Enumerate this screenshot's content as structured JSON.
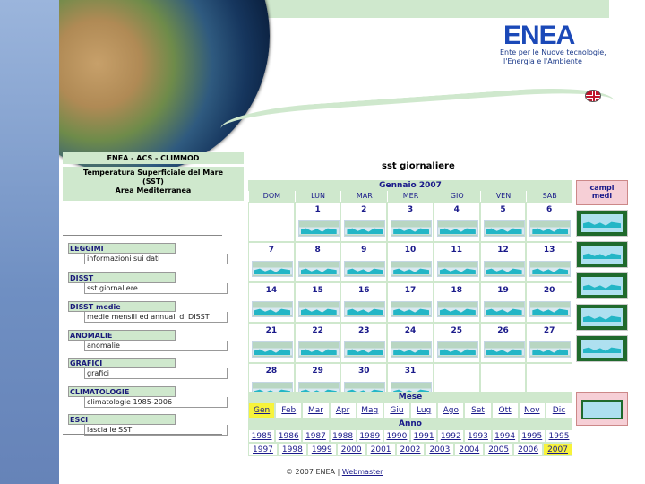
{
  "header": {
    "logo_text": "ENEA",
    "logo_sub1": "Ente per le Nuove tecnologie,",
    "logo_sub2": "l'Energia e l'Ambiente"
  },
  "left": {
    "site_title": "ENEA - ACS - CLIMMOD",
    "sst_title1": "Temperatura Superficiale del Mare",
    "sst_title2": "(SST)",
    "sst_title3": "Area Mediterranea",
    "sections": [
      {
        "head": "LEGGIMI",
        "link": "informazioni sui dati"
      },
      {
        "head": "DISST",
        "link": "sst giornaliere"
      },
      {
        "head": "DISST medie",
        "link": "medie mensili ed annuali di DISST"
      },
      {
        "head": "ANOMALIE",
        "link": "anomalie"
      },
      {
        "head": "GRAFICI",
        "link": "grafici"
      },
      {
        "head": "CLIMATOLOGIE",
        "link": "climatologie 1985-2006"
      },
      {
        "head": "ESCI",
        "link": "lascia le SST"
      }
    ]
  },
  "calendar": {
    "title": "sst giornaliere",
    "month_label": "Gennaio 2007",
    "dow": [
      "DOM",
      "LUN",
      "MAR",
      "MER",
      "GIO",
      "VEN",
      "SAB"
    ],
    "weeks": [
      [
        "",
        "1",
        "2",
        "3",
        "4",
        "5",
        "6"
      ],
      [
        "7",
        "8",
        "9",
        "10",
        "11",
        "12",
        "13"
      ],
      [
        "14",
        "15",
        "16",
        "17",
        "18",
        "19",
        "20"
      ],
      [
        "21",
        "22",
        "23",
        "24",
        "25",
        "26",
        "27"
      ],
      [
        "28",
        "29",
        "30",
        "31",
        "",
        "",
        ""
      ]
    ]
  },
  "right": {
    "campi_line1": "campi",
    "campi_line2": "medi"
  },
  "mese": {
    "label": "Mese",
    "months": [
      "Gen",
      "Feb",
      "Mar",
      "Apr",
      "Mag",
      "Giu",
      "Lug",
      "Ago",
      "Set",
      "Ott",
      "Nov",
      "Dic"
    ],
    "selected": "Gen"
  },
  "anno": {
    "label": "Anno",
    "row1": [
      "1985",
      "1986",
      "1987",
      "1988",
      "1989",
      "1990",
      "1991",
      "1992",
      "1993",
      "1994",
      "1995",
      "1995"
    ],
    "row2": [
      "1997",
      "1998",
      "1999",
      "2000",
      "2001",
      "2002",
      "2003",
      "2004",
      "2005",
      "2006",
      "2007"
    ],
    "selected": "2007"
  },
  "footer": {
    "copyright": "© 2007 ENEA",
    "sep": "|",
    "webmaster": "Webmaster"
  },
  "colors": {
    "accent_green": "#cfe8cd",
    "link_blue": "#1a1a8a",
    "highlight": "#f7f33a",
    "pink": "#f6cfd6"
  }
}
